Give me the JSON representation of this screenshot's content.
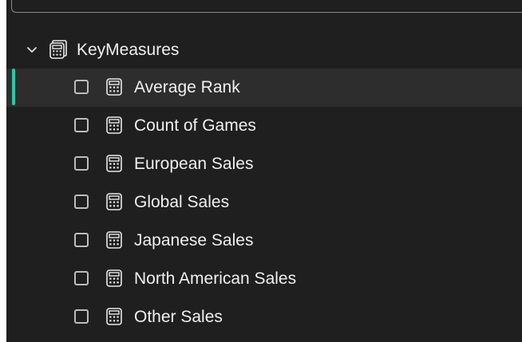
{
  "table": {
    "name": "KeyMeasures",
    "expanded": true,
    "icon": "calculator-table-icon"
  },
  "measures": [
    {
      "label": "Average Rank",
      "checked": false,
      "selected": true,
      "icon": "calculator-icon"
    },
    {
      "label": "Count of Games",
      "checked": false,
      "selected": false,
      "icon": "calculator-icon"
    },
    {
      "label": "European Sales",
      "checked": false,
      "selected": false,
      "icon": "calculator-icon"
    },
    {
      "label": "Global Sales",
      "checked": false,
      "selected": false,
      "icon": "calculator-icon"
    },
    {
      "label": "Japanese Sales",
      "checked": false,
      "selected": false,
      "icon": "calculator-icon"
    },
    {
      "label": "North American Sales",
      "checked": false,
      "selected": false,
      "icon": "calculator-icon"
    },
    {
      "label": "Other Sales",
      "checked": false,
      "selected": false,
      "icon": "calculator-icon"
    }
  ],
  "colors": {
    "pane_background": "#1f1f1f",
    "selected_row": "#2d2d2d",
    "selection_accent": "#2ec4a6",
    "text": "#f0f0f0"
  }
}
